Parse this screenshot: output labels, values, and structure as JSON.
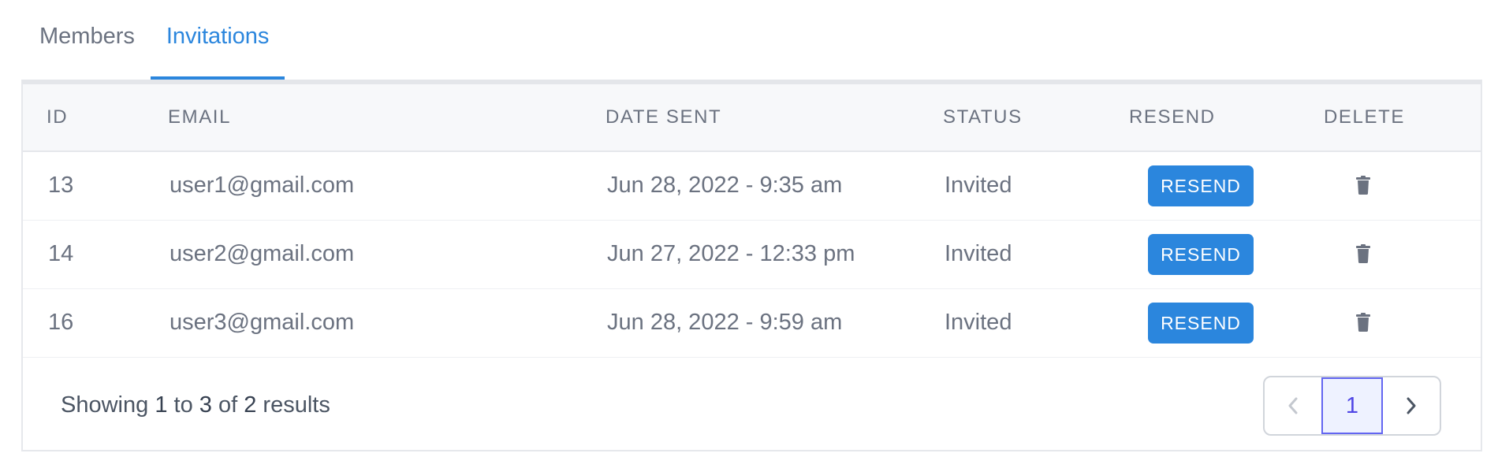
{
  "tabs": [
    {
      "label": "Members",
      "active": false
    },
    {
      "label": "Invitations",
      "active": true
    }
  ],
  "table": {
    "headers": {
      "id": "ID",
      "email": "EMAIL",
      "date_sent": "DATE SENT",
      "status": "STATUS",
      "resend": "RESEND",
      "delete": "DELETE"
    },
    "rows": [
      {
        "id": "13",
        "email": "user1@gmail.com",
        "date_sent": "Jun 28, 2022 - 9:35 am",
        "status": "Invited",
        "resend_label": "RESEND"
      },
      {
        "id": "14",
        "email": "user2@gmail.com",
        "date_sent": "Jun 27, 2022 - 12:33 pm",
        "status": "Invited",
        "resend_label": "RESEND"
      },
      {
        "id": "16",
        "email": "user3@gmail.com",
        "date_sent": "Jun 28, 2022 - 9:59 am",
        "status": "Invited",
        "resend_label": "RESEND"
      }
    ]
  },
  "footer": {
    "showing_prefix": "Showing",
    "from": "1",
    "to_word": "to",
    "to": "3",
    "of_word": "of",
    "total": "2",
    "results_word": "results"
  },
  "pagination": {
    "current_page": "1",
    "prev_icon": "chevron-left-icon",
    "next_icon": "chevron-right-icon"
  },
  "colors": {
    "accent": "#2b86dd",
    "active_page_border": "#6366f1",
    "active_page_bg": "#eef2ff"
  }
}
